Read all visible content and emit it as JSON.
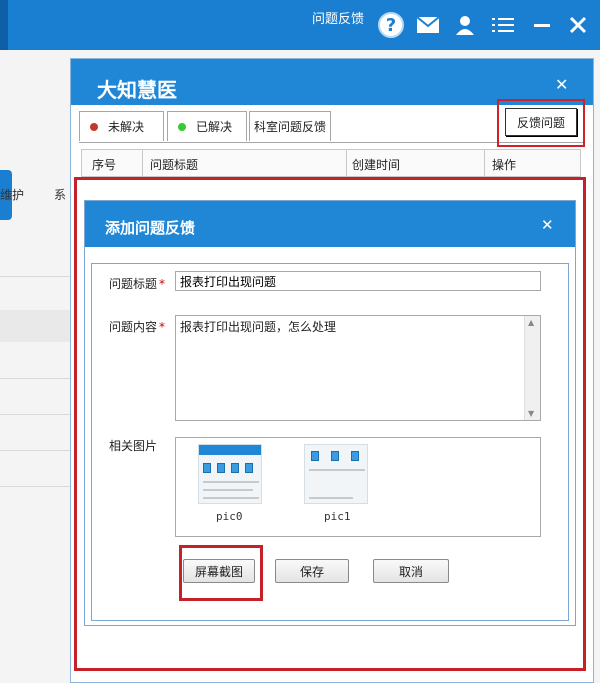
{
  "topbar": {
    "feedback_title": "问题反馈",
    "icons": [
      "help-icon",
      "mail-icon",
      "user-icon",
      "menu-icon",
      "minimize-icon",
      "close-icon"
    ],
    "accent_color": "#1a7fd1"
  },
  "background": {
    "label1": "维护",
    "label2": "系"
  },
  "main_dialog": {
    "title": "大知慧医",
    "tabs": [
      {
        "label": "未解决",
        "dot_color": "#c0392b"
      },
      {
        "label": "已解决",
        "dot_color": "#33cc33"
      },
      {
        "label": "科室问题反馈"
      }
    ],
    "feedback_button": "反馈问题",
    "columns": [
      "序号",
      "问题标题",
      "创建时间",
      "操作"
    ]
  },
  "add_dialog": {
    "title": "添加问题反馈",
    "title_label": "问题标题",
    "title_value": "报表打印出现问题",
    "content_label": "问题内容",
    "content_value": "报表打印出现问题，怎么处理",
    "images_label": "相关图片",
    "images": [
      "pic0",
      "pic1"
    ],
    "buttons": {
      "capture": "屏幕截图",
      "save": "保存",
      "cancel": "取消"
    }
  }
}
